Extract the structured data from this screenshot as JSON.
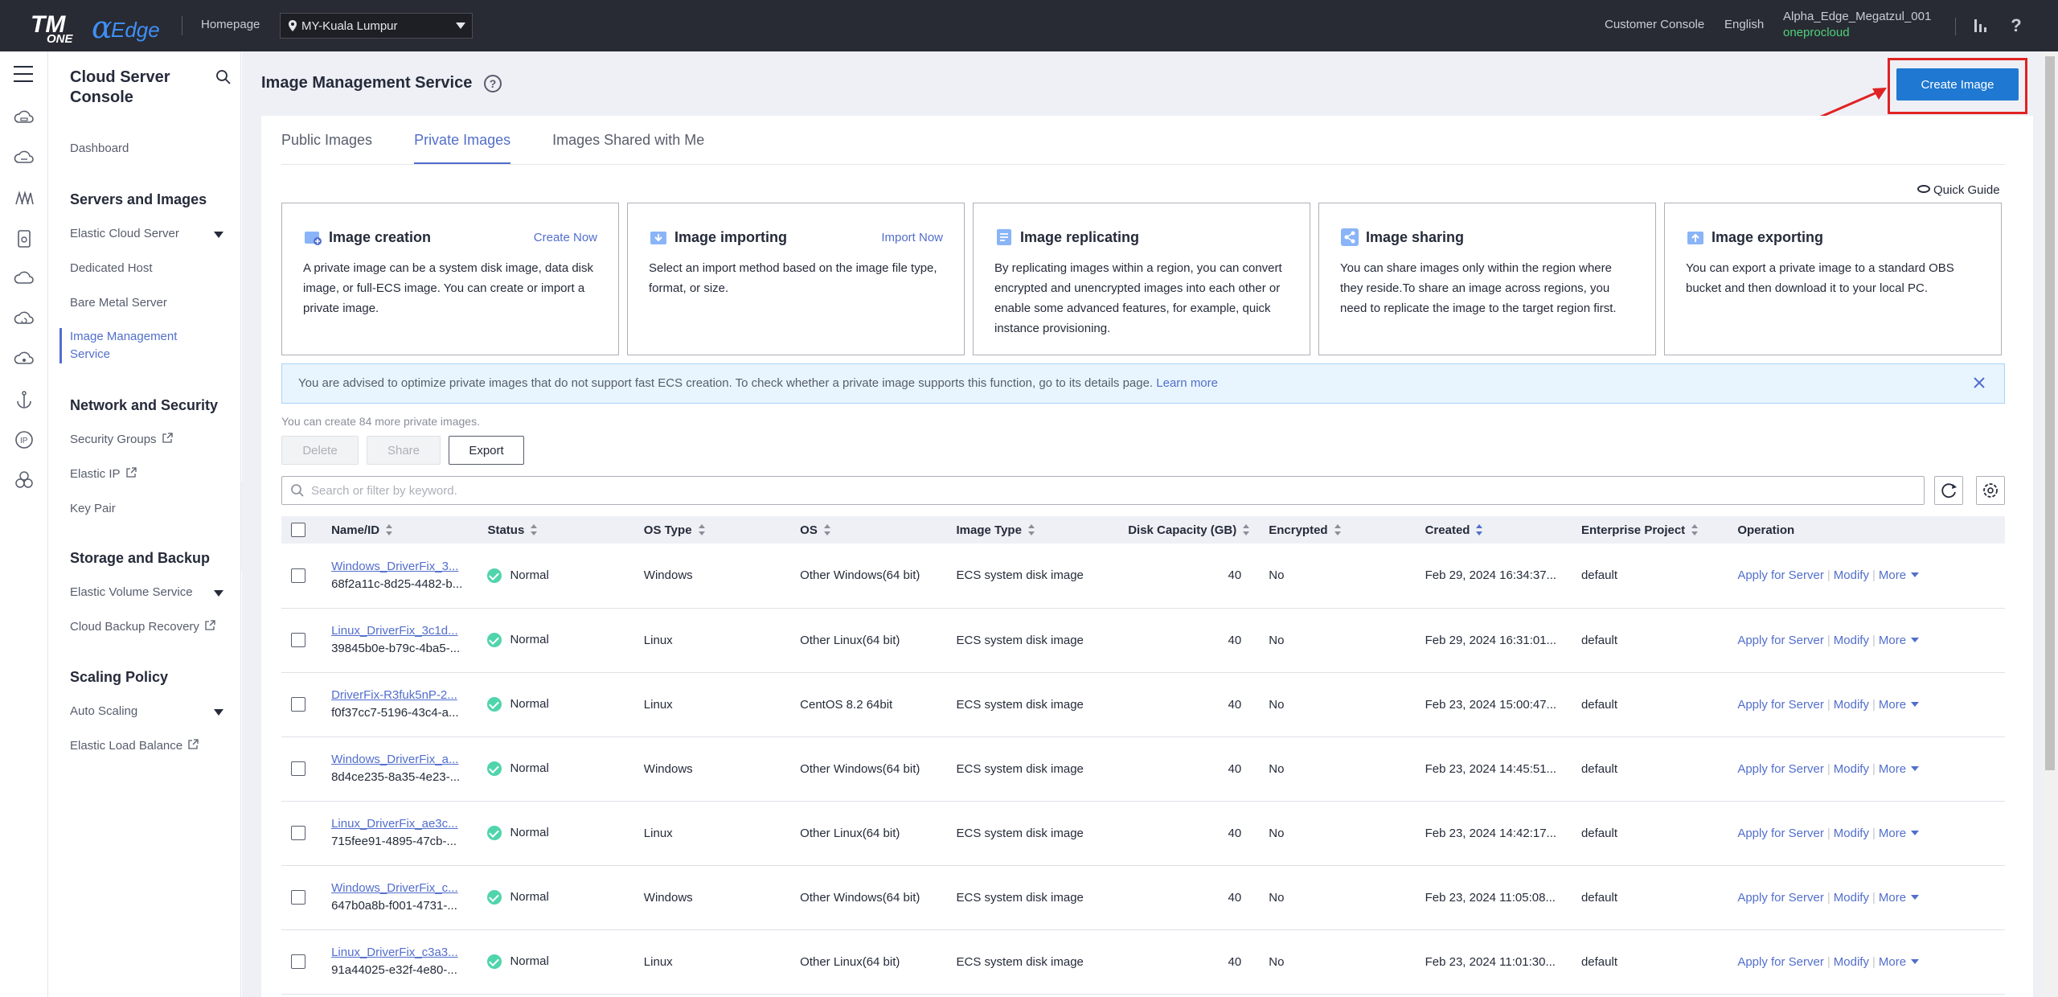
{
  "topbar": {
    "brand_tm": "TM",
    "brand_one": "ONE",
    "brand_alpha": "α",
    "brand_edge": "Edge",
    "homepage": "Homepage",
    "region": "MY-Kuala Lumpur",
    "customer_console": "Customer Console",
    "language": "English",
    "username": "Alpha_Edge_Megatzul_001",
    "org": "oneprocloud",
    "help_glyph": "?"
  },
  "sidebar": {
    "title": "Cloud Server Console",
    "dashboard": "Dashboard",
    "groups": {
      "servers": "Servers and Images",
      "network": "Network and Security",
      "storage": "Storage and Backup",
      "scaling": "Scaling Policy"
    },
    "items": {
      "ecs": "Elastic Cloud Server",
      "dedicated_host": "Dedicated Host",
      "bare_metal": "Bare Metal Server",
      "ims_line1": "Image Management",
      "ims_line2": "Service",
      "security_groups": "Security Groups",
      "elastic_ip": "Elastic IP",
      "key_pair": "Key Pair",
      "evs": "Elastic Volume Service",
      "cbr": "Cloud Backup Recovery",
      "auto_scaling": "Auto Scaling",
      "elb": "Elastic Load Balance"
    }
  },
  "page": {
    "title": "Image Management Service",
    "help_glyph": "?",
    "create_button": "Create Image",
    "tabs": [
      "Public Images",
      "Private Images",
      "Images Shared with Me"
    ],
    "quick_guide": "Quick Guide"
  },
  "features": [
    {
      "title": "Image creation",
      "action": "Create Now",
      "desc": "A private image can be a system disk image, data disk image, or full-ECS image. You can create or import a private image."
    },
    {
      "title": "Image importing",
      "action": "Import Now",
      "desc": "Select an import method based on the image file type, format, or size."
    },
    {
      "title": "Image replicating",
      "action": "",
      "desc": "By replicating images within a region, you can convert encrypted and unencrypted images into each other or enable some advanced features, for example, quick instance provisioning."
    },
    {
      "title": "Image sharing",
      "action": "",
      "desc": "You can share images only within the region where they reside.To share an image across regions, you need to replicate the image to the target region first."
    },
    {
      "title": "Image exporting",
      "action": "",
      "desc": "You can export a private image to a standard OBS bucket and then download it to your local PC."
    }
  ],
  "notice": {
    "text": "You are advised to optimize private images that do not support fast ECS creation. To check whether a private image supports this function, go to its details page.",
    "link": "Learn more"
  },
  "toolbar": {
    "quota": "You can create 84 more private images.",
    "delete": "Delete",
    "share": "Share",
    "export": "Export",
    "search_placeholder": "Search or filter by keyword."
  },
  "table": {
    "columns": [
      "Name/ID",
      "Status",
      "OS Type",
      "OS",
      "Image Type",
      "Disk Capacity (GB)",
      "Encrypted",
      "Created",
      "Enterprise Project",
      "Operation"
    ],
    "op_apply": "Apply for Server",
    "op_modify": "Modify",
    "op_more": "More",
    "rows": [
      {
        "name": "Windows_DriverFix_3...",
        "id": "68f2a11c-8d25-4482-b...",
        "status": "Normal",
        "os_type": "Windows",
        "os": "Other Windows(64 bit)",
        "image_type": "ECS system disk image",
        "disk": "40",
        "encrypted": "No",
        "created": "Feb 29, 2024 16:34:37...",
        "project": "default"
      },
      {
        "name": "Linux_DriverFix_3c1d...",
        "id": "39845b0e-b79c-4ba5-...",
        "status": "Normal",
        "os_type": "Linux",
        "os": "Other Linux(64 bit)",
        "image_type": "ECS system disk image",
        "disk": "40",
        "encrypted": "No",
        "created": "Feb 29, 2024 16:31:01...",
        "project": "default"
      },
      {
        "name": "DriverFix-R3fuk5nP-2...",
        "id": "f0f37cc7-5196-43c4-a...",
        "status": "Normal",
        "os_type": "Linux",
        "os": "CentOS 8.2 64bit",
        "image_type": "ECS system disk image",
        "disk": "40",
        "encrypted": "No",
        "created": "Feb 23, 2024 15:00:47...",
        "project": "default"
      },
      {
        "name": "Windows_DriverFix_a...",
        "id": "8d4ce235-8a35-4e23-...",
        "status": "Normal",
        "os_type": "Windows",
        "os": "Other Windows(64 bit)",
        "image_type": "ECS system disk image",
        "disk": "40",
        "encrypted": "No",
        "created": "Feb 23, 2024 14:45:51...",
        "project": "default"
      },
      {
        "name": "Linux_DriverFix_ae3c...",
        "id": "715fee91-4895-47cb-...",
        "status": "Normal",
        "os_type": "Linux",
        "os": "Other Linux(64 bit)",
        "image_type": "ECS system disk image",
        "disk": "40",
        "encrypted": "No",
        "created": "Feb 23, 2024 14:42:17...",
        "project": "default"
      },
      {
        "name": "Windows_DriverFix_c...",
        "id": "647b0a8b-f001-4731-...",
        "status": "Normal",
        "os_type": "Windows",
        "os": "Other Windows(64 bit)",
        "image_type": "ECS system disk image",
        "disk": "40",
        "encrypted": "No",
        "created": "Feb 23, 2024 11:05:08...",
        "project": "default"
      },
      {
        "name": "Linux_DriverFix_c3a3...",
        "id": "91a44025-e32f-4e80-...",
        "status": "Normal",
        "os_type": "Linux",
        "os": "Other Linux(64 bit)",
        "image_type": "ECS system disk image",
        "disk": "40",
        "encrypted": "No",
        "created": "Feb 23, 2024 11:01:30...",
        "project": "default"
      }
    ]
  },
  "colors": {
    "accent": "#526ecc",
    "primary_button": "#1f78d1",
    "highlight_box": "#e02222",
    "status_normal": "#50d4ab",
    "topbar": "#282b33",
    "org_text": "#4fd17b"
  },
  "icons": {
    "rail": [
      "cloud-server-icon",
      "cloud-icon",
      "bare-metal-icon",
      "disk-icon",
      "cloud-storage-icon",
      "backup-icon",
      "cloud-network-icon",
      "anchor-icon",
      "ip-icon",
      "cluster-icon"
    ]
  }
}
